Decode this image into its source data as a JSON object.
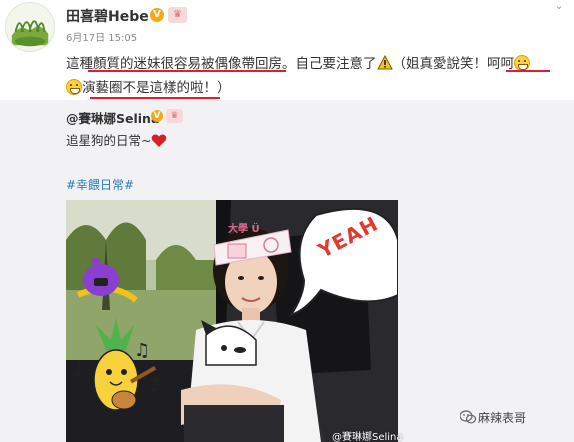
{
  "post": {
    "username": "田喜碧Hebe",
    "vip_mark": "V",
    "timestamp": "6月17日 15:05",
    "line1_a": "這種顏質的迷妹很容易被偶像帶回房。自己要注意了",
    "line1_b": "（姐真愛說笑！",
    "line1_c": "呵呵",
    "line2": "演藝圈不是這樣的啦！）"
  },
  "repost": {
    "username": "@賽琳娜Selina",
    "vip_mark": "V",
    "text": "追星狗的日常~",
    "hashtag": "#幸餵日常#"
  },
  "photo": {
    "sticker_text": "YEAH",
    "cap_text": "大學 Ü",
    "watermark": "@賽琳娜Selina"
  },
  "page_watermark": "麻辣表哥",
  "icons": {
    "warning": "warning-icon",
    "emoji": "grin-emoji-icon",
    "heart": "heart-icon",
    "chevron": "chevron-down-icon",
    "wechat": "wechat-icon"
  },
  "colors": {
    "underline": "#e41d2e",
    "hashtag": "#2b7bb8",
    "repost_bg": "#f2f2f5",
    "vip": "#f4a813"
  }
}
